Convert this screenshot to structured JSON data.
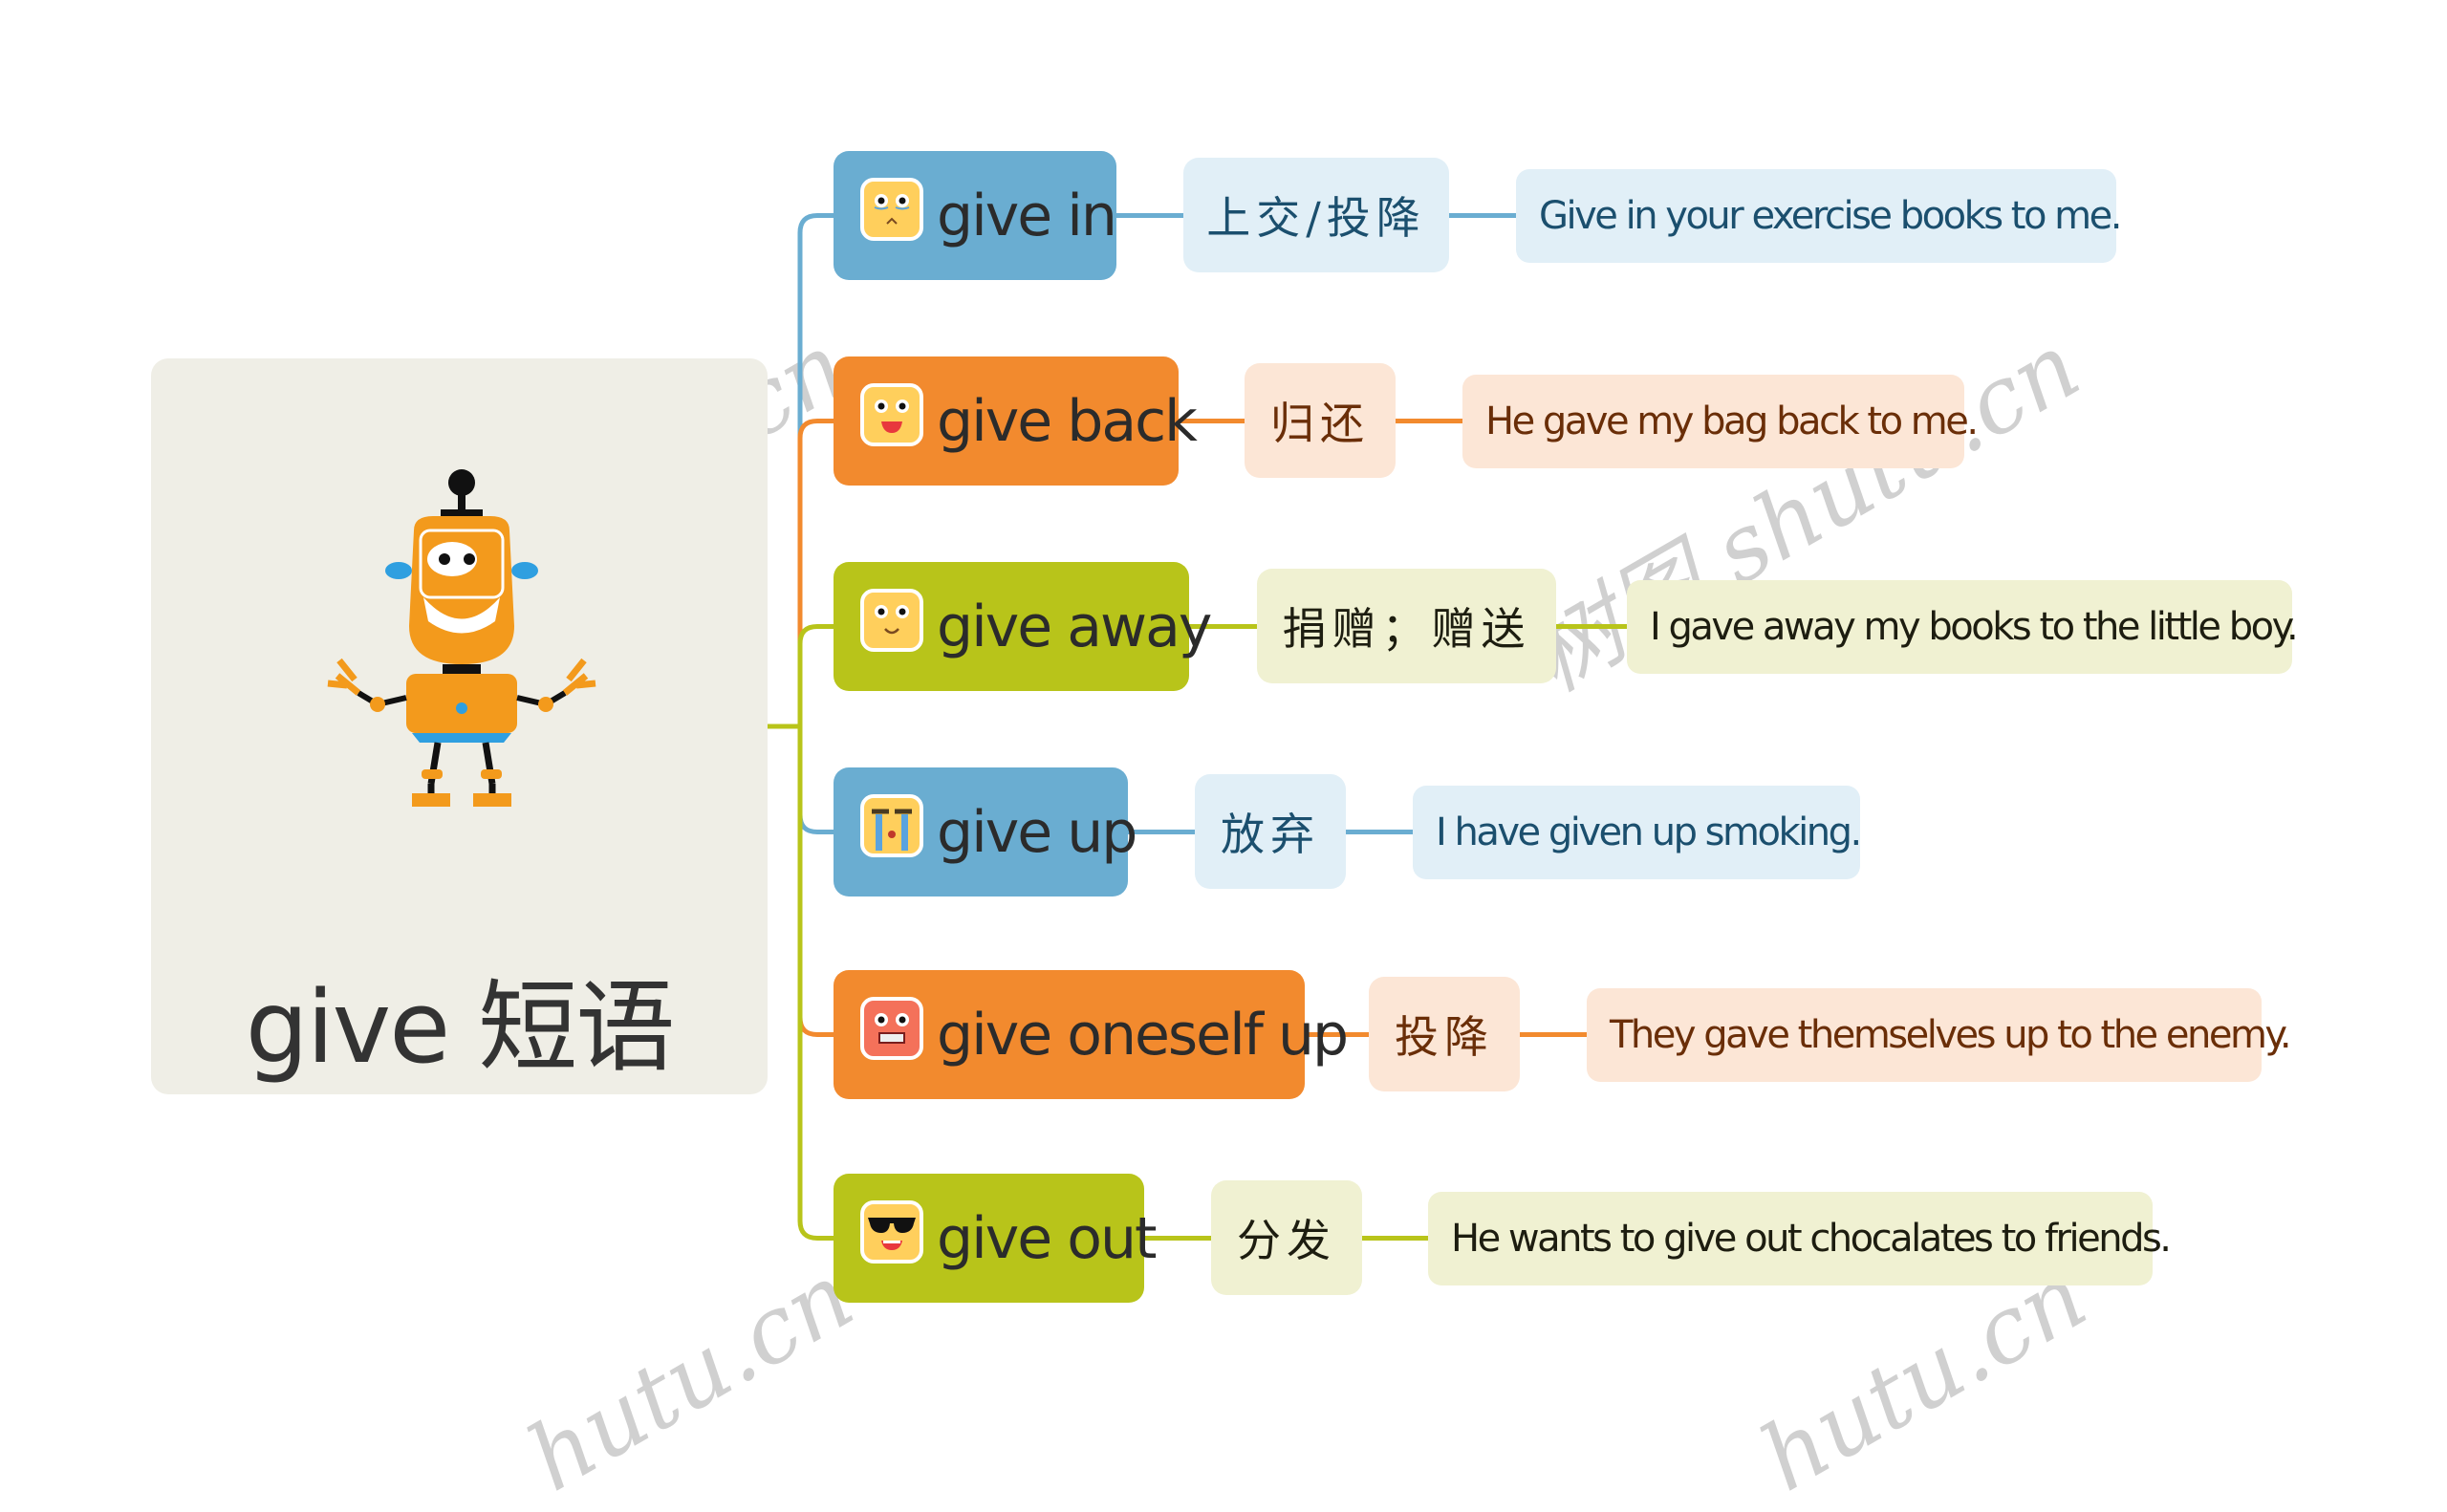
{
  "root": {
    "title": "give 短语",
    "illustration": "robot-illustration"
  },
  "colors": {
    "blue": "#6aadd1",
    "orange": "#f28a2e",
    "green": "#b8c41a",
    "root_bg": "#efeee6"
  },
  "branches": [
    {
      "phrase": "give in",
      "icon": "crying-face-icon",
      "color": "blue",
      "meaning": "上交/投降",
      "example": "Give in your exercise books to me."
    },
    {
      "phrase": "give back",
      "icon": "happy-face-icon",
      "color": "orange",
      "meaning": "归还",
      "example": "He gave my bag back to me."
    },
    {
      "phrase": "give away",
      "icon": "smiling-face-icon",
      "color": "green",
      "meaning": "捐赠；赠送",
      "example": "I gave away my books to the little boy."
    },
    {
      "phrase": "give up",
      "icon": "sobbing-face-icon",
      "color": "blue",
      "meaning": "放弃",
      "example": "I have given up smoking."
    },
    {
      "phrase": "give oneself up",
      "icon": "grimacing-face-icon",
      "color": "orange",
      "meaning": "投降",
      "example": "They gave themselves up to the enemy."
    },
    {
      "phrase": "give out",
      "icon": "sunglasses-face-icon",
      "color": "green",
      "meaning": "分发",
      "example": "He wants to give out chocalates to friends."
    }
  ],
  "watermark": {
    "text_full": "树图 shutu.cn",
    "text_partial": "hutu.cn"
  }
}
